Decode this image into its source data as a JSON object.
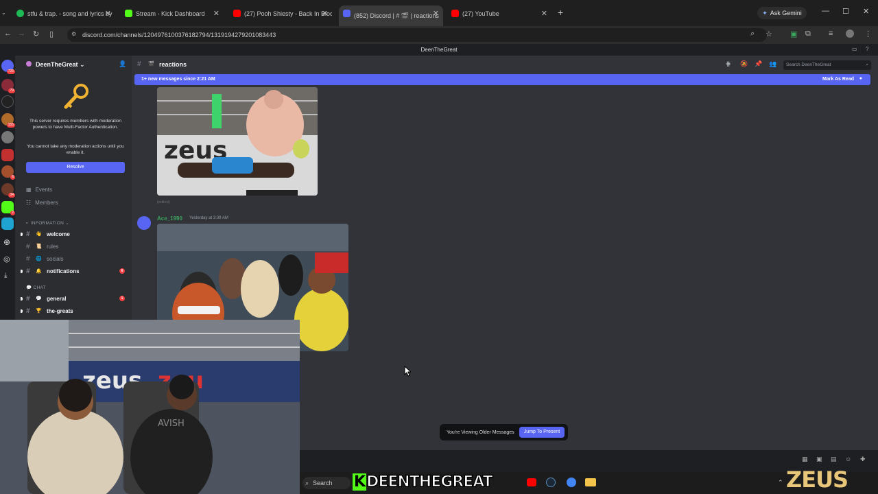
{
  "browser": {
    "tabs": [
      {
        "title": "stfu & trap. - song and lyrics by",
        "color": "#1db954"
      },
      {
        "title": "Stream - Kick Dashboard",
        "color": "#53fc18"
      },
      {
        "title": "(27) Pooh Shiesty - Back In Blood",
        "color": "#ff0000"
      },
      {
        "title": "(852) Discord | # 🎬 | reactions",
        "color": "#5865f2"
      },
      {
        "title": "(27) YouTube",
        "color": "#ff0000"
      }
    ],
    "new_tab": "+",
    "gemini_label": "Ask Gemini",
    "url": "discord.com/channels/1204976100376182794/1319194279201083443"
  },
  "discord": {
    "window_title": "DeenTheGreat",
    "server_name": "DeenTheGreat",
    "rail_badges": [
      "726",
      "79",
      "155",
      "8",
      "34",
      "2"
    ],
    "notice": {
      "line1": "This server requires members with moderation powers to have Multi-Factor Authentication.",
      "line2": "You cannot take any moderation actions until you enable it.",
      "resolve": "Resolve"
    },
    "sidebar_items": [
      "Events",
      "Members"
    ],
    "categories": [
      "INFORMATION",
      "CHAT"
    ],
    "channels_info": [
      {
        "name": "welcome",
        "emoji": "👋",
        "unread": true
      },
      {
        "name": "rules",
        "emoji": "📜",
        "unread": false
      },
      {
        "name": "socials",
        "emoji": "🌐",
        "unread": false
      },
      {
        "name": "notifications",
        "emoji": "🔔",
        "unread": true,
        "count": "6"
      }
    ],
    "channels_chat": [
      {
        "name": "general",
        "emoji": "💬",
        "unread": true,
        "count": "1"
      },
      {
        "name": "the-greats",
        "emoji": "🏆",
        "unread": true
      }
    ],
    "channel_header": "reactions",
    "search_placeholder": "Search DeenTheGreat",
    "new_messages": "1+ new messages since 2:21 AM",
    "mark_as_read": "Mark As Read",
    "edited": "(edited)",
    "message": {
      "author": "Ace_1990",
      "timestamp": "Yesterday at 3:09 AM"
    },
    "older_messages": "You're Viewing Older Messages",
    "jump": "Jump To Present"
  },
  "taskbar": {
    "search": "Search",
    "overlay_text": "DEENTHEGREAT",
    "watermark": "ZEUS"
  }
}
